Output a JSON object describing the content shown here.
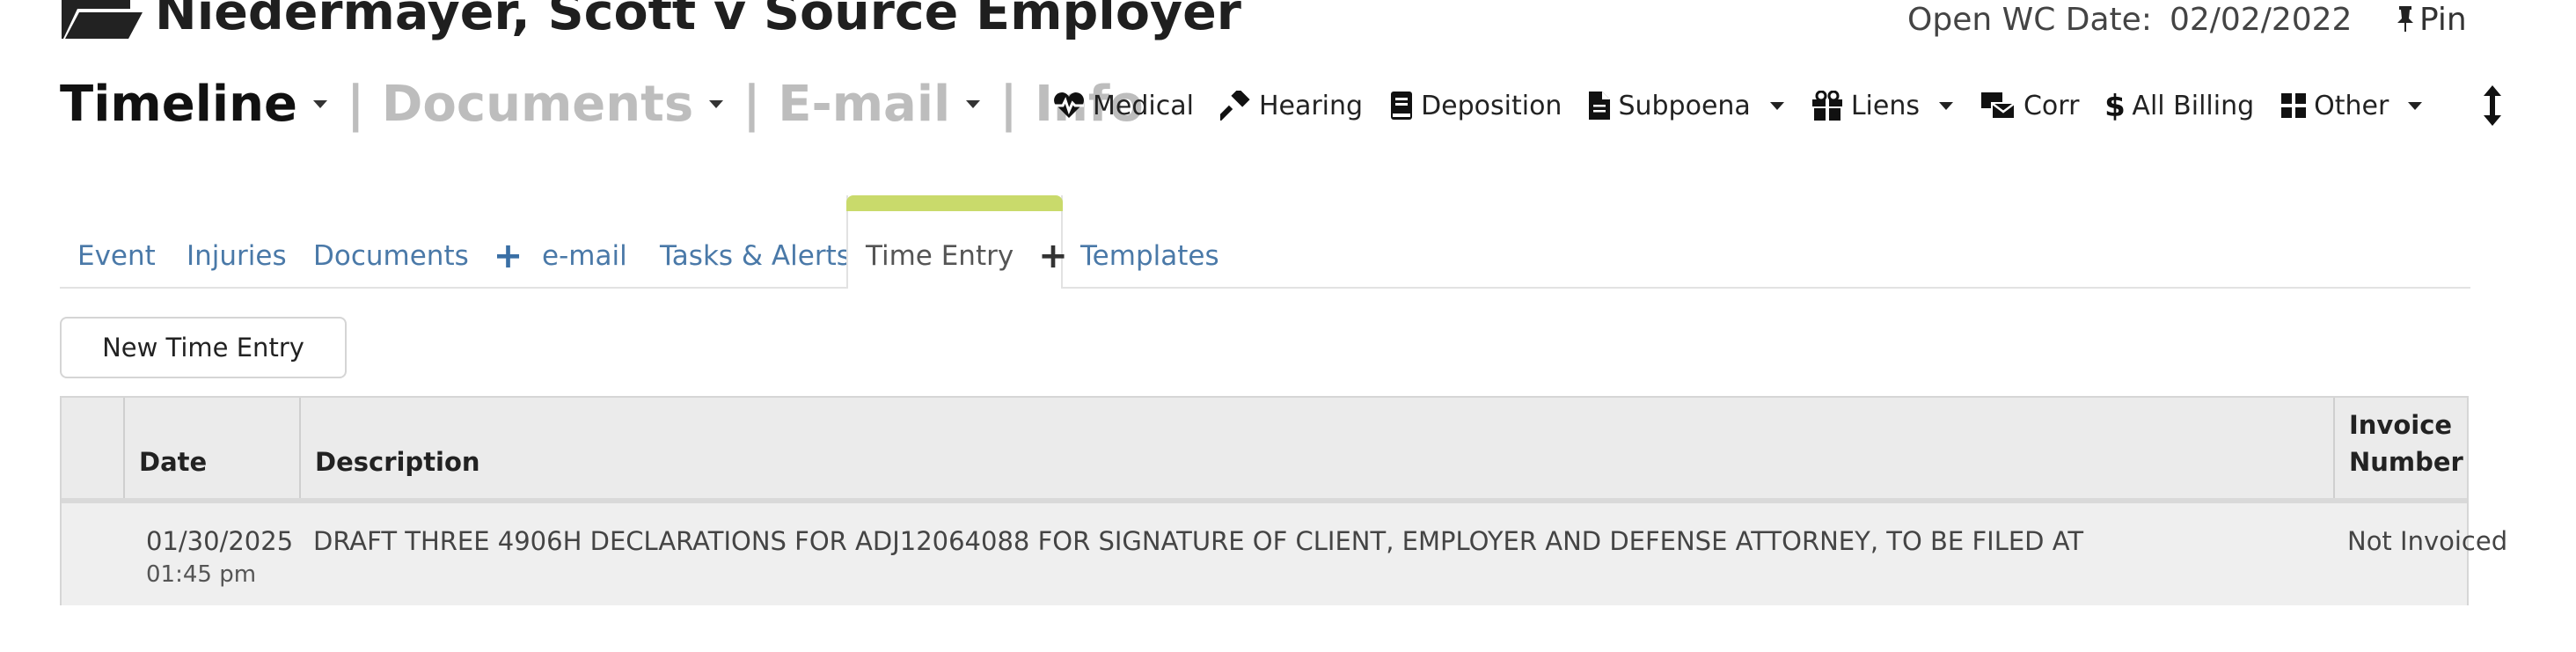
{
  "header": {
    "case_title": "Niedermayer, Scott v Source Employer",
    "open_date_label": "Open WC Date:",
    "open_date_value": "02/02/2022",
    "pin_label": "Pin"
  },
  "primary_nav": {
    "timeline": "Timeline",
    "documents": "| Documents",
    "email": "| E-mail",
    "info": "| Info"
  },
  "toolbar": {
    "medical": "Medical",
    "hearing": "Hearing",
    "deposition": "Deposition",
    "subpoena": "Subpoena",
    "liens": "Liens",
    "corr": "Corr",
    "all_billing": "All Billing",
    "other": "Other"
  },
  "tabs": [
    "Event",
    "Injuries",
    "Documents",
    "e-mail",
    "Tasks & Alerts",
    "Time Entry",
    "Templates"
  ],
  "active_tab": "Time Entry",
  "new_entry_button": "New Time Entry",
  "table": {
    "headers": {
      "date": "Date",
      "description": "Description",
      "invoice_line1": "Invoice",
      "invoice_line2": "Number"
    },
    "rows": [
      {
        "date": "01/30/2025",
        "time": "01:45 pm",
        "description": "DRAFT THREE 4906H DECLARATIONS FOR ADJ12064088 FOR SIGNATURE OF CLIENT, EMPLOYER AND DEFENSE ATTORNEY, TO BE FILED AT",
        "invoice": "Not Invoiced"
      }
    ]
  },
  "colors": {
    "active_tab_accent": "#c9da6b",
    "tab_link": "#4a79a8",
    "inactive_nav": "#bdbdbd"
  },
  "icons": [
    "folder-open-icon",
    "pin-icon",
    "heartbeat-icon",
    "gavel-icon",
    "book-icon",
    "file-icon",
    "gift-icon",
    "mail-bulk-icon",
    "dollar-icon",
    "grid-icon",
    "vertical-arrows-icon",
    "plus-icon"
  ]
}
